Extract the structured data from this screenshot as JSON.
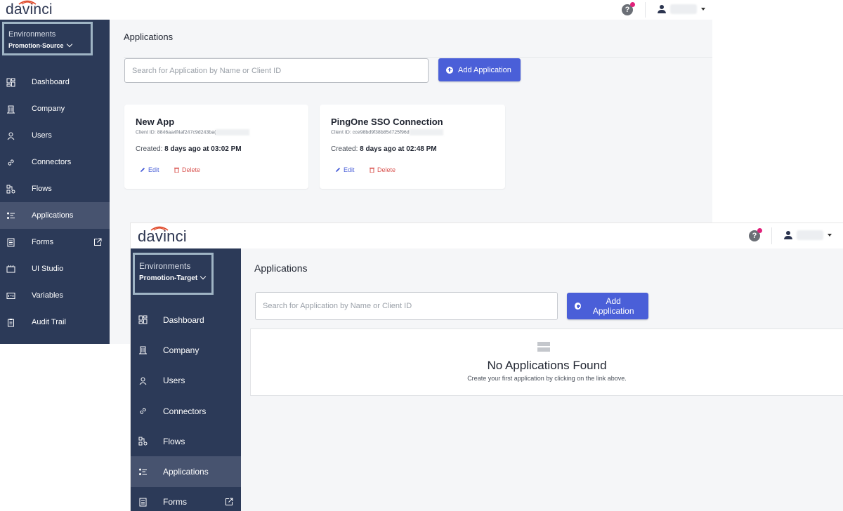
{
  "app": {
    "logo": "davinci",
    "help_glyph": "?"
  },
  "source_window": {
    "environment_label": "Environments",
    "environment_name": "Promotion-Source",
    "page_title": "Applications",
    "search_placeholder": "Search for Application by Name or Client ID",
    "add_button": "Add Application",
    "menu": [
      {
        "label": "Dashboard",
        "icon": "dashboard-icon"
      },
      {
        "label": "Company",
        "icon": "company-icon"
      },
      {
        "label": "Users",
        "icon": "users-icon"
      },
      {
        "label": "Connectors",
        "icon": "link-icon"
      },
      {
        "label": "Flows",
        "icon": "flows-icon"
      },
      {
        "label": "Applications",
        "icon": "applications-icon",
        "active": true
      },
      {
        "label": "Forms",
        "icon": "forms-icon",
        "external": true
      },
      {
        "label": "UI Studio",
        "icon": "ui-studio-icon"
      },
      {
        "label": "Variables",
        "icon": "variables-icon"
      },
      {
        "label": "Audit Trail",
        "icon": "audit-trail-icon"
      }
    ],
    "apps": [
      {
        "name": "New App",
        "client_id": "Client ID: 8846aa4f4af247c9d243ba(",
        "created_label": "Created:",
        "created_value": "8 days ago at 03:02 PM",
        "edit": "Edit",
        "delete": "Delete"
      },
      {
        "name": "PingOne SSO Connection",
        "client_id": "Client ID: cce98bd9f38b854725f96d",
        "created_label": "Created:",
        "created_value": "8 days ago at 02:48 PM",
        "edit": "Edit",
        "delete": "Delete"
      }
    ]
  },
  "target_window": {
    "environment_label": "Environments",
    "environment_name": "Promotion-Target",
    "page_title": "Applications",
    "search_placeholder": "Search for Application by Name or Client ID",
    "add_button": "Add Application",
    "menu": [
      {
        "label": "Dashboard",
        "icon": "dashboard-icon"
      },
      {
        "label": "Company",
        "icon": "company-icon"
      },
      {
        "label": "Users",
        "icon": "users-icon"
      },
      {
        "label": "Connectors",
        "icon": "link-icon"
      },
      {
        "label": "Flows",
        "icon": "flows-icon"
      },
      {
        "label": "Applications",
        "icon": "applications-icon",
        "active": true
      },
      {
        "label": "Forms",
        "icon": "forms-icon",
        "external": true
      }
    ],
    "empty_title": "No Applications Found",
    "empty_subtitle": "Create your first application by clicking on the link above."
  },
  "colors": {
    "sidebar": "#2c3a58",
    "sidebar_active": "#47536f",
    "accent": "#4a5fd8",
    "danger": "#d9534f",
    "notification": "#e0217a",
    "env_border": "#9fb4c4"
  }
}
